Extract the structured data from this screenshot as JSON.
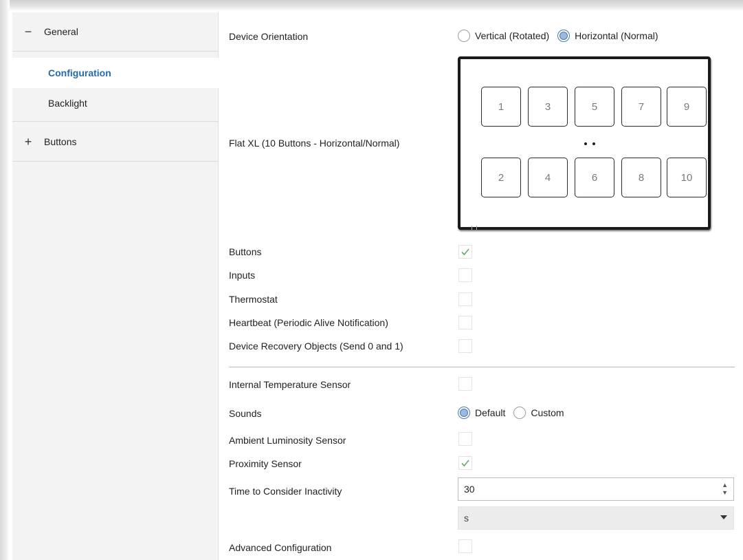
{
  "sidebar": {
    "general": {
      "toggle": "−",
      "label": "General"
    },
    "items": [
      {
        "label": "Configuration"
      },
      {
        "label": "Backlight"
      }
    ],
    "buttons": {
      "toggle": "+",
      "label": "Buttons"
    }
  },
  "orientation": {
    "label": "Device Orientation",
    "options": [
      "Vertical (Rotated)",
      "Horizontal (Normal)"
    ],
    "selected": "Horizontal (Normal)"
  },
  "device": {
    "label": "Flat XL (10 Buttons - Horizontal/Normal)",
    "top_buttons": [
      "1",
      "3",
      "5",
      "7",
      "9"
    ],
    "bottom_buttons": [
      "2",
      "4",
      "6",
      "8",
      "10"
    ]
  },
  "checks_a": [
    {
      "label": "Buttons",
      "checked": true
    },
    {
      "label": "Inputs",
      "checked": false
    },
    {
      "label": "Thermostat",
      "checked": false
    },
    {
      "label": "Heartbeat (Periodic Alive Notification)",
      "checked": false
    },
    {
      "label": "Device Recovery Objects (Send 0 and 1)",
      "checked": false
    }
  ],
  "internal_temp": {
    "label": "Internal Temperature Sensor",
    "checked": false
  },
  "sounds": {
    "label": "Sounds",
    "options": [
      "Default",
      "Custom"
    ],
    "selected": "Default"
  },
  "ambient": {
    "label": "Ambient Luminosity Sensor",
    "checked": false
  },
  "proximity": {
    "label": "Proximity Sensor",
    "checked": true
  },
  "inactivity": {
    "label": "Time to Consider Inactivity",
    "value": "30",
    "unit": "s"
  },
  "advanced": {
    "label": "Advanced Configuration",
    "checked": false
  },
  "colors": {
    "accent": "#2469b2",
    "check": "#4caf50"
  }
}
